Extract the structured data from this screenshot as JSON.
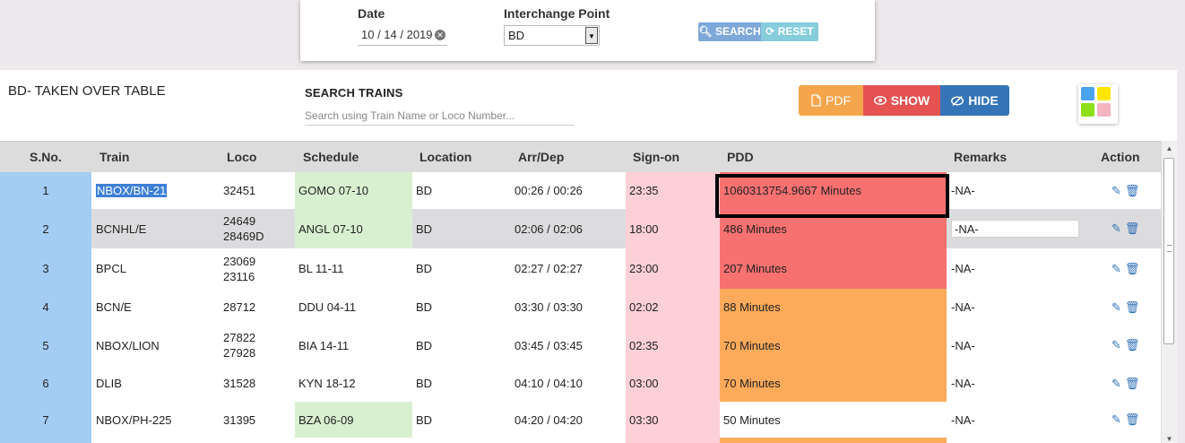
{
  "filter": {
    "date_label": "Date",
    "date_value": "10 / 14 / 2019",
    "interchange_label": "Interchange Point",
    "interchange_value": "BD",
    "search_button": "SEARCH",
    "reset_button": "RESET"
  },
  "panel": {
    "title": "BD- TAKEN OVER TABLE",
    "search_label": "SEARCH TRAINS",
    "search_placeholder": "Search using Train Name or Loco Number...",
    "pdf_button": "PDF",
    "show_button": "SHOW",
    "hide_button": "HIDE",
    "color_swatches": [
      "#4aa3ef",
      "#ffe600",
      "#8ee01a",
      "#f5b4c0"
    ]
  },
  "table": {
    "headers": {
      "sno": "S.No.",
      "train": "Train",
      "loco": "Loco",
      "schedule": "Schedule",
      "location": "Location",
      "arrdep": "Arr/Dep",
      "signon": "Sign-on",
      "pdd": "PDD",
      "remarks": "Remarks",
      "action": "Action"
    },
    "rows": [
      {
        "sno": "1",
        "train": "NBOX/BN-21",
        "loco1": "32451",
        "loco2": "",
        "schedule": "GOMO 07-10",
        "location": "BD",
        "arrdep": "00:26 / 00:26",
        "signon": "23:35",
        "pdd": "1060313754.9667 Minutes",
        "remarks": "-NA-"
      },
      {
        "sno": "2",
        "train": "BCNHL/E",
        "loco1": "24649",
        "loco2": "28469D",
        "schedule": "ANGL 07-10",
        "location": "BD",
        "arrdep": "02:06 / 02:06",
        "signon": "18:00",
        "pdd": "486 Minutes",
        "remarks": "-NA-"
      },
      {
        "sno": "3",
        "train": "BPCL",
        "loco1": "23069",
        "loco2": "23116",
        "schedule": "BL 11-11",
        "location": "BD",
        "arrdep": "02:27 / 02:27",
        "signon": "23:00",
        "pdd": "207 Minutes",
        "remarks": "-NA-"
      },
      {
        "sno": "4",
        "train": "BCN/E",
        "loco1": "28712",
        "loco2": "",
        "schedule": "DDU 04-11",
        "location": "BD",
        "arrdep": "03:30 / 03:30",
        "signon": "02:02",
        "pdd": "88 Minutes",
        "remarks": "-NA-"
      },
      {
        "sno": "5",
        "train": "NBOX/LION",
        "loco1": "27822",
        "loco2": "27928",
        "schedule": "BIA 14-11",
        "location": "BD",
        "arrdep": "03:45 / 03:45",
        "signon": "02:35",
        "pdd": "70 Minutes",
        "remarks": "-NA-"
      },
      {
        "sno": "6",
        "train": "DLIB",
        "loco1": "31528",
        "loco2": "",
        "schedule": "KYN 18-12",
        "location": "BD",
        "arrdep": "04:10 / 04:10",
        "signon": "03:00",
        "pdd": "70 Minutes",
        "remarks": "-NA-"
      },
      {
        "sno": "7",
        "train": "NBOX/PH-225",
        "loco1": "31395",
        "loco2": "",
        "schedule": "BZA 06-09",
        "location": "BD",
        "arrdep": "04:20 / 04:20",
        "signon": "03:30",
        "pdd": "50 Minutes",
        "remarks": "-NA-"
      }
    ]
  },
  "colors": {
    "sno_bg": "#a4cdf5",
    "signon_bg": "#fdd0d8",
    "schedule_green": "#d9f0d0",
    "pdd_red": "#f87171",
    "pdd_orange": "#fdaa5a",
    "alt_row": "#dcdcde"
  }
}
